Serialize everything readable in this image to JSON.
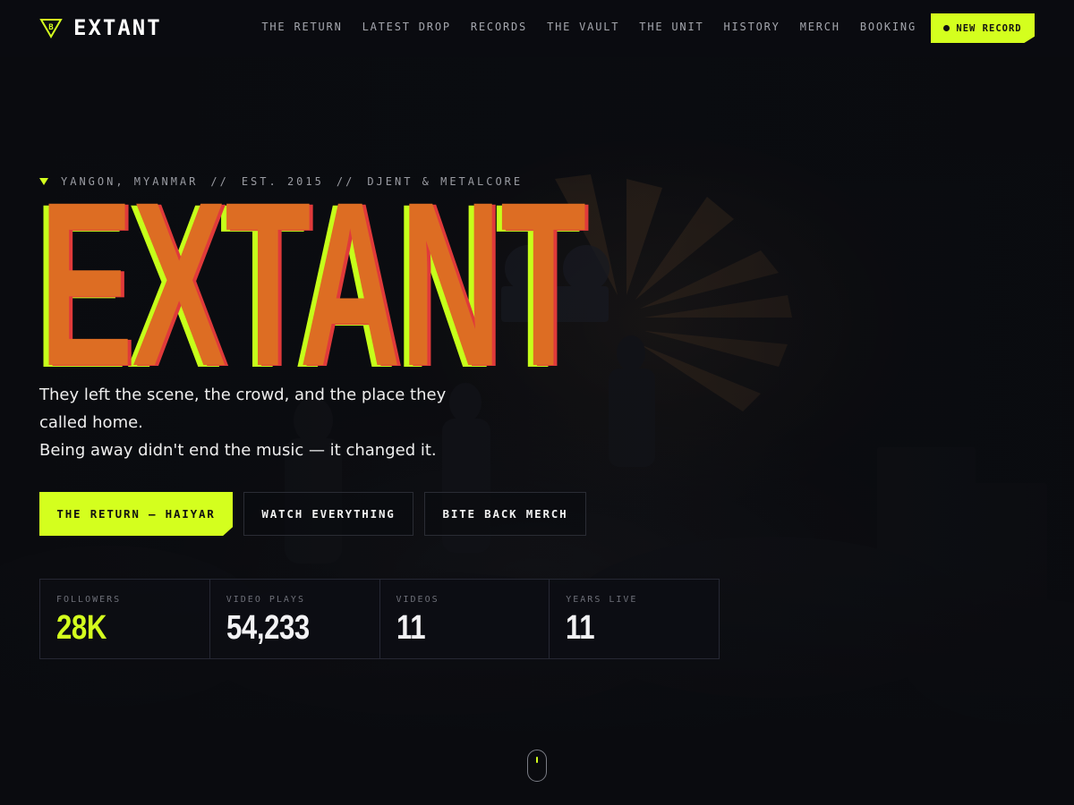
{
  "nav": {
    "brand": "EXTANT",
    "links": [
      "THE RETURN",
      "LATEST DROP",
      "RECORDS",
      "THE VAULT",
      "THE UNIT",
      "HISTORY",
      "MERCH",
      "BOOKING"
    ],
    "cta_label": "NEW RECORD"
  },
  "hero": {
    "eyebrow": {
      "location": "YANGON, MYANMAR",
      "separator": "//",
      "established": "EST. 2015",
      "genre": "DJENT & METALCORE"
    },
    "title": "EXTANT",
    "tagline_lines": [
      "They left the scene, the crowd, and the place they called home.",
      "Being away didn't end the music — it changed it."
    ],
    "buttons": {
      "primary": "THE RETURN — HAIYAR",
      "watch": "WATCH EVERYTHING",
      "merch": "BITE BACK MERCH"
    }
  },
  "stats": [
    {
      "label": "FOLLOWERS",
      "value": "28K",
      "accent": true
    },
    {
      "label": "VIDEO PLAYS",
      "value": "54,233",
      "accent": false
    },
    {
      "label": "VIDEOS",
      "value": "11",
      "accent": false
    },
    {
      "label": "YEARS LIVE",
      "value": "11",
      "accent": false
    }
  ],
  "colors": {
    "accent": "#d4ff1e",
    "title_orange": "#dd6d23",
    "title_red": "#e03a3a",
    "background": "#0b0c10"
  },
  "icons": {
    "brand_logo": "triangle-b-logo-icon",
    "eyebrow_marker": "triangle-down-icon",
    "cta_dot": "dot-icon",
    "scroll": "mouse-scroll-icon"
  }
}
